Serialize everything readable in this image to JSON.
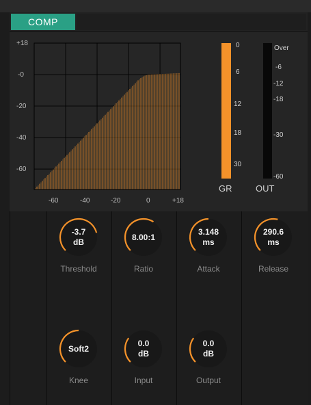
{
  "tab": {
    "label": "COMP"
  },
  "graph": {
    "y_labels": [
      "+18",
      "-0",
      "-20",
      "-40",
      "-60"
    ],
    "x_labels": [
      "-60",
      "-40",
      "-20",
      "0",
      "+18"
    ]
  },
  "meters": {
    "gr": {
      "label": "GR",
      "scale": [
        "0",
        "6",
        "12",
        "18",
        "30"
      ]
    },
    "out": {
      "label": "OUT",
      "scale": [
        "Over",
        "-6",
        "-12",
        "-18",
        "-30",
        "-60"
      ]
    }
  },
  "knobs": {
    "threshold": {
      "value1": "-3.7",
      "value2": "dB",
      "label": "Threshold"
    },
    "ratio": {
      "value1": "8.00:1",
      "value2": "",
      "label": "Ratio"
    },
    "attack": {
      "value1": "3.148",
      "value2": "ms",
      "label": "Attack"
    },
    "release": {
      "value1": "290.6",
      "value2": "ms",
      "label": "Release"
    },
    "knee": {
      "value1": "Soft2",
      "value2": "",
      "label": "Knee"
    },
    "input": {
      "value1": "0.0",
      "value2": "dB",
      "label": "Input"
    },
    "output": {
      "value1": "0.0",
      "value2": "dB",
      "label": "Output"
    }
  },
  "colors": {
    "accent": "#2aa085",
    "orange": "#f4922a",
    "panel": "#252525"
  }
}
